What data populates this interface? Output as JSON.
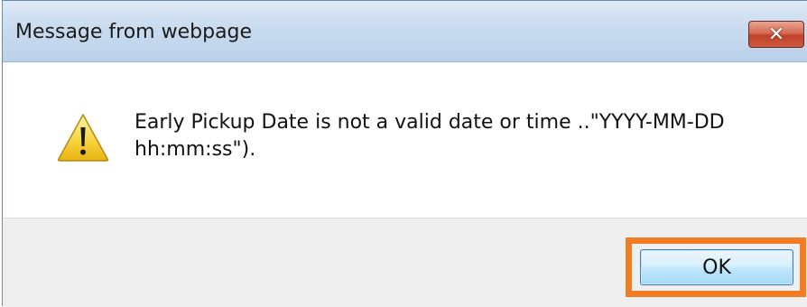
{
  "dialog": {
    "title": "Message from webpage",
    "close_glyph": "✕",
    "icon": "warning-icon",
    "message": "Early Pickup Date is not a valid date or time ..\"YYYY-MM-DD hh:mm:ss\").",
    "ok_label": "OK"
  },
  "colors": {
    "highlight": "#f07d23",
    "close_button": "#c2412a",
    "titlebar": "#c9dbef"
  }
}
